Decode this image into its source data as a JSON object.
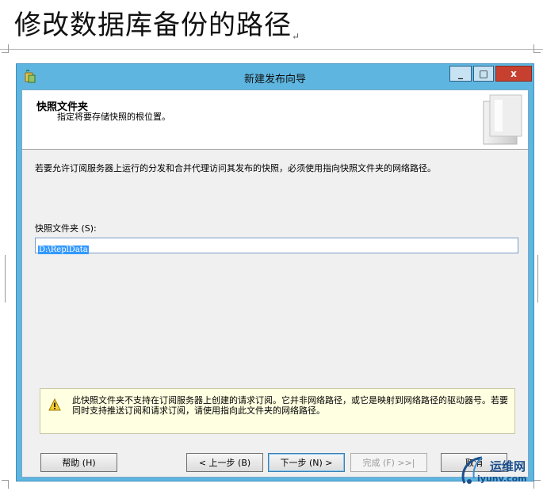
{
  "doc": {
    "heading": "修改数据库备份的路径",
    "paragraph_mark": "↵"
  },
  "window": {
    "title": "新建发布向导",
    "caption_buttons": {
      "minimize": "_",
      "maximize": "□",
      "close": "x"
    }
  },
  "header": {
    "title": "快照文件夹",
    "subtitle": "指定将要存储快照的根位置。"
  },
  "body": {
    "description": "若要允许订阅服务器上运行的分发和合并代理访问其发布的快照，必须使用指向快照文件夹的网络路径。",
    "folder_label": "快照文件夹 (S):",
    "folder_value": "D:\\ReplData"
  },
  "warning": {
    "text": "此快照文件夹不支持在订阅服务器上创建的请求订阅。它并非网络路径，或它是映射到网络路径的驱动器号。若要同时支持推送订阅和请求订阅，请使用指向此文件夹的网络路径。"
  },
  "buttons": {
    "help": "帮助 (H)",
    "back": "< 上一步 (B)",
    "next": "下一步 (N) >",
    "finish": "完成 (F) >>|",
    "cancel": "取消"
  },
  "watermark": {
    "line1": "运维网",
    "line2": "iyunv.com"
  },
  "colors": {
    "window_frame": "#5eb6e0",
    "close_button": "#c7402f",
    "selection": "#3399ff",
    "warning_bg": "#ffffe1"
  }
}
